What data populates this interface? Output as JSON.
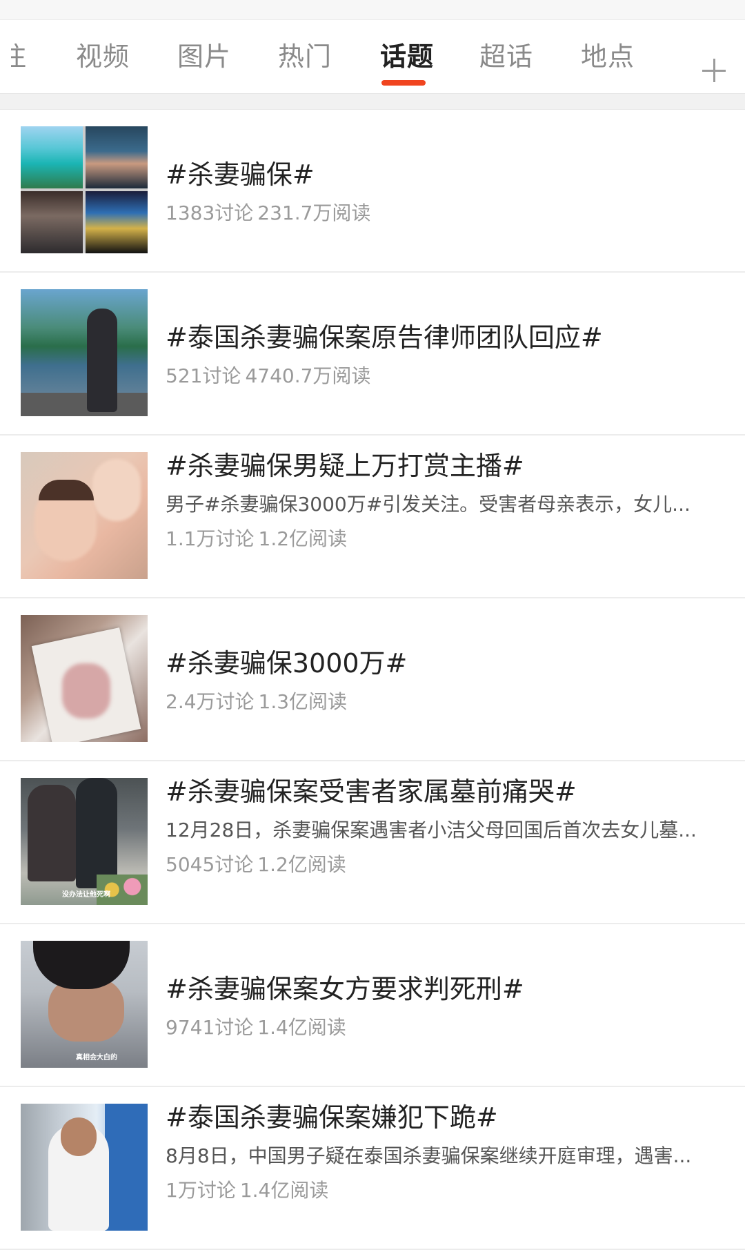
{
  "tabs": [
    {
      "label": "注",
      "active": false
    },
    {
      "label": "视频",
      "active": false
    },
    {
      "label": "图片",
      "active": false
    },
    {
      "label": "热门",
      "active": false
    },
    {
      "label": "话题",
      "active": true
    },
    {
      "label": "超话",
      "active": false
    },
    {
      "label": "地点",
      "active": false
    }
  ],
  "tab_plus_icon": "plus-icon",
  "accent_color": "#f0441f",
  "topics": [
    {
      "title": "#杀妻骗保#",
      "description": "",
      "discussion": "1383讨论",
      "reads": "231.7万阅读"
    },
    {
      "title": "#泰国杀妻骗保案原告律师团队回应#",
      "description": "",
      "discussion": "521讨论",
      "reads": "4740.7万阅读"
    },
    {
      "title": "#杀妻骗保男疑上万打赏主播#",
      "description": "男子#杀妻骗保3000万#引发关注。受害者母亲表示，女儿...",
      "discussion": "1.1万讨论",
      "reads": "1.2亿阅读"
    },
    {
      "title": "#杀妻骗保3000万#",
      "description": "",
      "discussion": "2.4万讨论",
      "reads": "1.3亿阅读"
    },
    {
      "title": "#杀妻骗保案受害者家属墓前痛哭#",
      "description": "12月28日，杀妻骗保案遇害者小洁父母回国后首次去女儿墓...",
      "discussion": "5045讨论",
      "reads": "1.2亿阅读",
      "thumb_caption": "没办法让他死啊"
    },
    {
      "title": "#杀妻骗保案女方要求判死刑#",
      "description": "",
      "discussion": "9741讨论",
      "reads": "1.4亿阅读",
      "thumb_caption": "真相会大白的"
    },
    {
      "title": "#泰国杀妻骗保案嫌犯下跪#",
      "description": "8月8日，中国男子疑在泰国杀妻骗保案继续开庭审理，遇害...",
      "discussion": "1万讨论",
      "reads": "1.4亿阅读"
    }
  ]
}
